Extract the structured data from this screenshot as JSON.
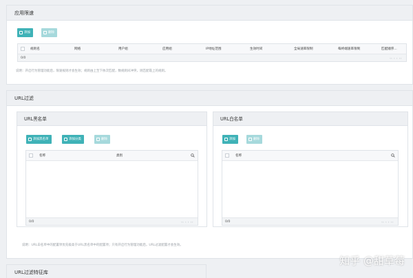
{
  "sections": {
    "rate_limit": {
      "title": "应用限速",
      "add_label": "添加",
      "delete_label": "删除",
      "columns": [
        "规则名",
        "网络",
        "用户组",
        "应用组",
        "IP地址范围",
        "生效时间",
        "全局速率限制",
        "每终端速率限制",
        "匹配顺序..."
      ],
      "footer_count": "0/0",
      "pager": "‹‹ ‹ › ››",
      "note": "说明：开启行为管理功能后，限速规则才会生效；规则由上至下依次匹配，数规则间冲突，则匹配靠上的规则。"
    },
    "url_filter": {
      "title": "URL过滤",
      "blacklist": {
        "title": "URL黑名单",
        "add_list_label": "添加黑名单",
        "add_category_label": "添加分类",
        "delete_label": "删除",
        "columns": [
          "名称",
          "类别"
        ],
        "footer_count": "0/0",
        "pager": "‹‹ ‹ › ››"
      },
      "whitelist": {
        "title": "URL白名单",
        "add_label": "添加",
        "delete_label": "删除",
        "columns": [
          "名称"
        ],
        "footer_count": "0/0",
        "pager": "‹‹ ‹ › ››"
      },
      "note": "说明：URL白名单中的配置项优先级高于URL黑名单中的配置项；只有开启行为管理功能后，URL过滤配置才会生效。"
    },
    "url_feature": {
      "title": "URL过滤特征库"
    }
  },
  "watermark": "知乎 @甜草莓",
  "colors": {
    "primary_button": "#3fb2b7",
    "disabled_button": "#a6d9dc",
    "header_bg": "#eef0f3"
  }
}
